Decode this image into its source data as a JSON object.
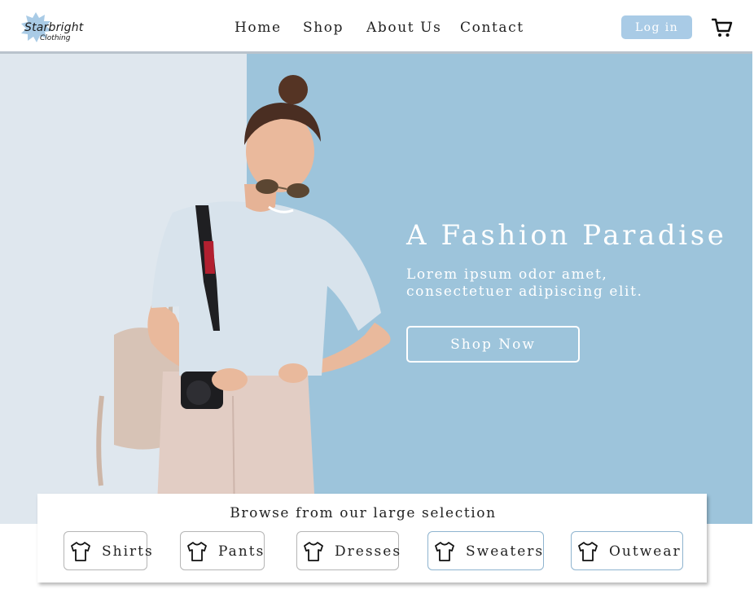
{
  "brand": {
    "name": "Starbright",
    "tagline": "Clothing",
    "logo_color": "#a9cbe6"
  },
  "nav": {
    "items": [
      {
        "label": "Home"
      },
      {
        "label": "Shop"
      },
      {
        "label": "About Us"
      },
      {
        "label": "Contact"
      }
    ]
  },
  "header": {
    "login_label": "Log in",
    "cart_icon": "cart-icon"
  },
  "hero": {
    "title": "A Fashion Paradise",
    "subtitle": "Lorem ipsum odor amet, consectetuer adipiscing elit.",
    "cta_label": "Shop Now",
    "image": "hero-photo",
    "bg_left": "#dfe7ee",
    "bg_right": "#9dc4db"
  },
  "categories": {
    "title": "Browse from our large selection",
    "icon": "shirt-icon",
    "items": [
      {
        "label": "Shirts"
      },
      {
        "label": "Pants"
      },
      {
        "label": "Dresses"
      },
      {
        "label": "Sweaters"
      },
      {
        "label": "Outwear"
      }
    ]
  },
  "colors": {
    "accent": "#a9cbe6",
    "text": "#222222"
  }
}
